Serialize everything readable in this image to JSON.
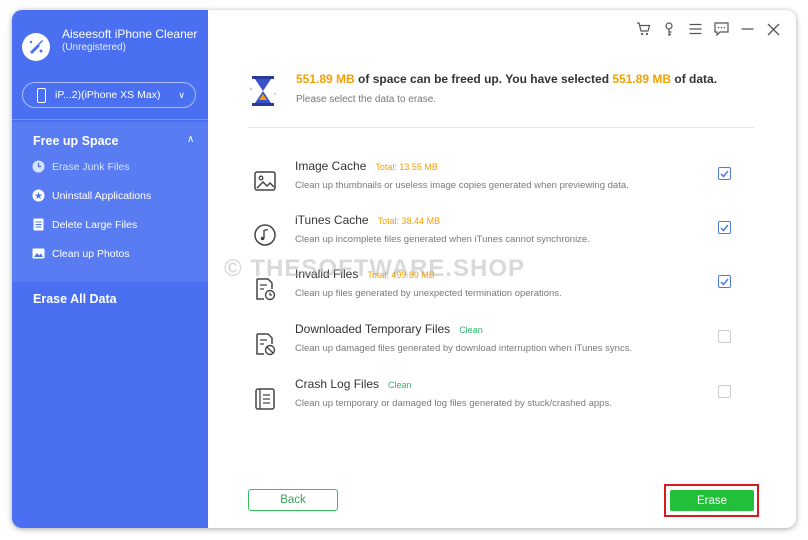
{
  "app": {
    "name": "Aiseesoft iPhone Cleaner",
    "status": "(Unregistered)"
  },
  "device": {
    "label": "iP...2)(iPhone XS Max)"
  },
  "sidebar": {
    "section_title": "Free up Space",
    "items": [
      {
        "label": "Erase Junk Files",
        "icon": "clock-icon"
      },
      {
        "label": "Uninstall Applications",
        "icon": "star-icon"
      },
      {
        "label": "Delete Large Files",
        "icon": "file-icon"
      },
      {
        "label": "Clean up Photos",
        "icon": "photo-icon"
      }
    ],
    "erase_all": "Erase All Data"
  },
  "summary": {
    "amount1": "551.89 MB",
    "text1": " of space can be freed up. You have selected ",
    "amount2": "551.89 MB",
    "text2": " of data.",
    "hint": "Please select the data to erase."
  },
  "items": [
    {
      "title": "Image Cache",
      "badge": "Total: 13.55 MB",
      "badge_type": "total",
      "desc": "Clean up thumbnails or useless image copies generated when previewing data.",
      "checked": true,
      "icon": "image-icon"
    },
    {
      "title": "iTunes Cache",
      "badge": "Total: 38.44 MB",
      "badge_type": "total",
      "desc": "Clean up incomplete files generated when iTunes cannot synchronize.",
      "checked": true,
      "icon": "music-icon"
    },
    {
      "title": "Invalid Files",
      "badge": "Total: 499.89 MB",
      "badge_type": "total",
      "desc": "Clean up files generated by unexpected termination operations.",
      "checked": true,
      "icon": "invalid-file-icon"
    },
    {
      "title": "Downloaded Temporary Files",
      "badge": "Clean",
      "badge_type": "clean",
      "desc": "Clean up damaged files generated by download interruption when iTunes syncs.",
      "checked": false,
      "icon": "temp-file-icon"
    },
    {
      "title": "Crash Log Files",
      "badge": "Clean",
      "badge_type": "clean",
      "desc": "Clean up temporary or damaged log files generated by stuck/crashed apps.",
      "checked": false,
      "icon": "log-file-icon"
    }
  ],
  "watermark": "© THESOFTWARE.SHOP",
  "buttons": {
    "back": "Back",
    "erase": "Erase"
  },
  "colors": {
    "sidebar": "#4a6ff0",
    "accent_orange": "#f5a000",
    "clean_green": "#2bb86a",
    "erase_green": "#22bf3a",
    "highlight_red": "#d71a1a"
  }
}
